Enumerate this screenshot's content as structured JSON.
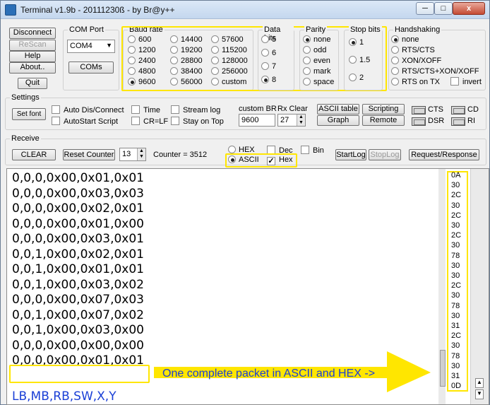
{
  "window": {
    "title": "Terminal v1.9b - 20111230ß - by Br@y++",
    "controls": {
      "minimize": "─",
      "maximize": "□",
      "close": "x"
    }
  },
  "connection": {
    "disconnect": "Disconnect",
    "rescan": "ReScan",
    "help": "Help",
    "about": "About..",
    "quit": "Quit"
  },
  "com_port": {
    "label": "COM Port",
    "selected": "COM4",
    "coms_button": "COMs"
  },
  "baud_rate": {
    "label": "Baud rate",
    "options": [
      "600",
      "1200",
      "2400",
      "4800",
      "9600",
      "14400",
      "19200",
      "28800",
      "38400",
      "56000",
      "57600",
      "115200",
      "128000",
      "256000",
      "custom"
    ],
    "selected": "9600"
  },
  "data_bits": {
    "label": "Data bits",
    "options": [
      "5",
      "6",
      "7",
      "8"
    ],
    "selected": "8"
  },
  "parity": {
    "label": "Parity",
    "options": [
      "none",
      "odd",
      "even",
      "mark",
      "space"
    ],
    "selected": "none"
  },
  "stop_bits": {
    "label": "Stop bits",
    "options": [
      "1",
      "1.5",
      "2"
    ],
    "selected": "1"
  },
  "handshaking": {
    "label": "Handshaking",
    "options": [
      "none",
      "RTS/CTS",
      "XON/XOFF",
      "RTS/CTS+XON/XOFF",
      "RTS on TX"
    ],
    "selected": "none",
    "invert": "invert"
  },
  "settings": {
    "label": "Settings",
    "set_font": "Set font",
    "auto_dis_connect": "Auto Dis/Connect",
    "autostart_script": "AutoStart Script",
    "time": "Time",
    "cr_lf": "CR=LF",
    "stream_log": "Stream log",
    "stay_on_top": "Stay on Top",
    "custom_br_label": "custom BR",
    "custom_br_value": "9600",
    "rx_clear_label": "Rx Clear",
    "rx_clear_value": "27",
    "ascii_table": "ASCII table",
    "graph": "Graph",
    "scripting": "Scripting",
    "remote": "Remote",
    "leds": {
      "cts": "CTS",
      "cd": "CD",
      "dsr": "DSR",
      "ri": "RI"
    }
  },
  "receive": {
    "label": "Receive",
    "clear": "CLEAR",
    "reset_counter": "Reset Counter",
    "counter_value": "13",
    "counter_text": "Counter =  3512",
    "hex": "HEX",
    "ascii": "ASCII",
    "dec": "Dec",
    "hex_check": "Hex",
    "bin": "Bin",
    "mode_selected": "ASCII",
    "start_log": "StartLog",
    "stop_log": "StopLog",
    "request_response": "Request/Response"
  },
  "received_lines": [
    "0,0,0,0x00,0x01,0x01",
    "0,0,0,0x00,0x03,0x03",
    "0,0,0,0x00,0x02,0x01",
    "0,0,0,0x00,0x01,0x00",
    "0,0,0,0x00,0x03,0x01",
    "0,0,1,0x00,0x02,0x01",
    "0,0,1,0x00,0x01,0x01",
    "0,0,1,0x00,0x03,0x02",
    "0,0,0,0x00,0x07,0x03",
    "0,0,1,0x00,0x07,0x02",
    "0,0,1,0x00,0x03,0x00",
    "0,0,0,0x00,0x00,0x00",
    "0,0,0,0x00,0x01,0x01"
  ],
  "legend_line": "LB,MB,RB,SW,X,Y",
  "hex_values": [
    "0A",
    "30",
    "2C",
    "30",
    "2C",
    "30",
    "2C",
    "30",
    "78",
    "30",
    "30",
    "2C",
    "30",
    "78",
    "30",
    "31",
    "2C",
    "30",
    "78",
    "30",
    "31",
    "0D"
  ],
  "annotation": "One complete packet in ASCII and HEX ->",
  "colors": {
    "highlight": "#ffe600",
    "annotation_text": "#1a3fd6",
    "legend_text": "#1a3fd6"
  }
}
